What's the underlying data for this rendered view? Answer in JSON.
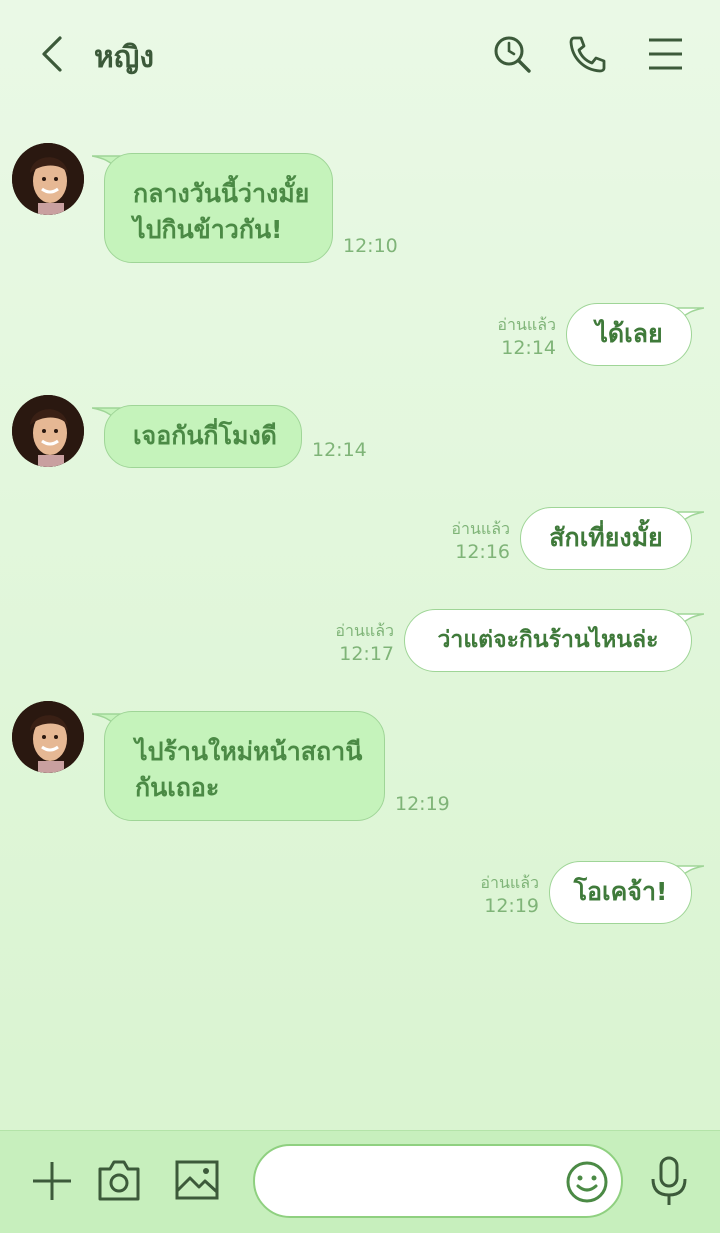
{
  "header": {
    "title": "หญิง"
  },
  "messages": [
    {
      "dir": "in",
      "lines": [
        "กลางวันนี้ว่างมั้ย",
        "ไปกินข้าวกัน!"
      ],
      "time": "12:10"
    },
    {
      "dir": "out",
      "lines": [
        "ได้เลย"
      ],
      "read": "อ่านแล้ว",
      "time": "12:14"
    },
    {
      "dir": "in",
      "lines": [
        "เจอกันกี่โมงดี"
      ],
      "time": "12:14"
    },
    {
      "dir": "out",
      "lines": [
        "สักเที่ยงมั้ย"
      ],
      "read": "อ่านแล้ว",
      "time": "12:16"
    },
    {
      "dir": "out",
      "lines": [
        "ว่าแต่จะกินร้านไหนล่ะ"
      ],
      "read": "อ่านแล้ว",
      "time": "12:17"
    },
    {
      "dir": "in",
      "lines": [
        "ไปร้านใหม่หน้าสถานี",
        "กันเถอะ"
      ],
      "time": "12:19"
    },
    {
      "dir": "out",
      "lines": [
        "โอเคจ้า!"
      ],
      "read": "อ่านแล้ว",
      "time": "12:19"
    }
  ],
  "icons": [
    "back-icon",
    "search-icon",
    "phone-icon",
    "menu-icon",
    "plus-icon",
    "camera-icon",
    "image-icon",
    "emoji-icon",
    "mic-icon"
  ],
  "colors": {
    "accent": "#4b8a45",
    "bubble_in": "#c5f3bb",
    "bubble_out": "#ffffff",
    "bottom_bar": "#c7efbd"
  }
}
